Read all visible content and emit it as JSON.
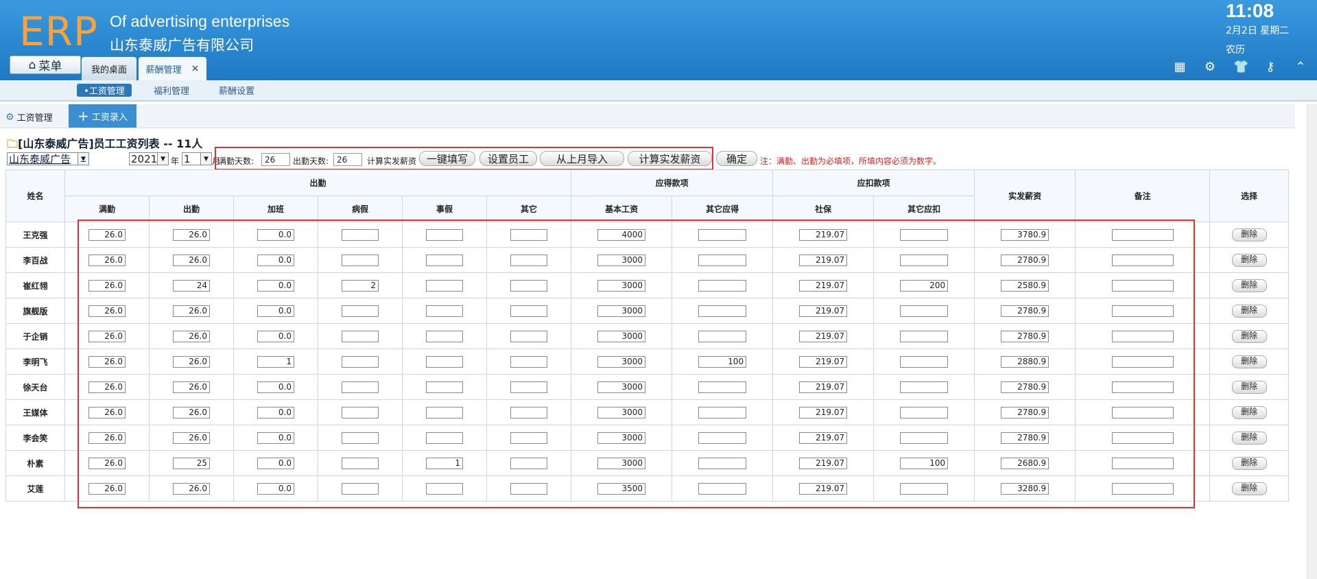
{
  "header": {
    "logo": "ERP",
    "brand_en": "Of advertising enterprises",
    "brand_cn": "山东泰威广告有限公司",
    "time": "11:08",
    "date": "2月2日 星期二",
    "lunar": "农历",
    "menu_label": "菜单",
    "tabs": [
      {
        "label": "我的桌面"
      },
      {
        "label": "薪酬管理",
        "close": "×"
      }
    ],
    "icons": [
      "grid-icon",
      "gear-icon",
      "shirt-icon",
      "key-icon",
      "collapse-icon"
    ]
  },
  "subnav": {
    "items": [
      {
        "label": "•工资管理",
        "active": true
      },
      {
        "label": "福利管理"
      },
      {
        "label": "薪酬设置"
      }
    ]
  },
  "toolbar": {
    "salary_label": "工资管理",
    "entry_label": "工资录入"
  },
  "form": {
    "title": "[山东泰威广告]员工工资列表 -- 11人",
    "company": "山东泰威广告",
    "year": "2021",
    "year_unit": "年",
    "month": "1",
    "month_unit": "月",
    "full_days_label": "满勤天数:",
    "full_days": "26",
    "attend_days_label": "出勤天数:",
    "attend_days": "26",
    "calc_label": "计算实发薪资",
    "buttons": {
      "fill": "一键填写",
      "set_staff": "设置员工",
      "import_last": "从上月导入",
      "calc": "计算实发薪资",
      "confirm": "确定"
    },
    "note": "注：满勤、出勤为必填项，所填内容必须为数字。"
  },
  "table": {
    "headers": {
      "name": "姓名",
      "attendance": "出勤",
      "payable": "应得款项",
      "deduct": "应扣款项",
      "net": "实发薪资",
      "remark": "备注",
      "select": "选择",
      "full": "满勤",
      "attend": "出勤",
      "overtime": "加班",
      "sick": "病假",
      "personal": "事假",
      "other": "其它",
      "base": "基本工资",
      "other_pay": "其它应得",
      "social": "社保",
      "other_deduct": "其它应扣"
    },
    "delete_label": "删除",
    "rows": [
      {
        "name": "王克强",
        "full": "26.0",
        "attend": "26.0",
        "overtime": "0.0",
        "sick": "",
        "personal": "",
        "other": "",
        "base": "4000",
        "other_pay": "",
        "social": "219.07",
        "other_deduct": "",
        "net": "3780.9",
        "remark": ""
      },
      {
        "name": "李百战",
        "full": "26.0",
        "attend": "26.0",
        "overtime": "0.0",
        "sick": "",
        "personal": "",
        "other": "",
        "base": "3000",
        "other_pay": "",
        "social": "219.07",
        "other_deduct": "",
        "net": "2780.9",
        "remark": ""
      },
      {
        "name": "崔红翎",
        "full": "26.0",
        "attend": "24",
        "overtime": "0.0",
        "sick": "2",
        "personal": "",
        "other": "",
        "base": "3000",
        "other_pay": "",
        "social": "219.07",
        "other_deduct": "200",
        "net": "2580.9",
        "remark": ""
      },
      {
        "name": "旗舰版",
        "full": "26.0",
        "attend": "26.0",
        "overtime": "0.0",
        "sick": "",
        "personal": "",
        "other": "",
        "base": "3000",
        "other_pay": "",
        "social": "219.07",
        "other_deduct": "",
        "net": "2780.9",
        "remark": ""
      },
      {
        "name": "于企销",
        "full": "26.0",
        "attend": "26.0",
        "overtime": "0.0",
        "sick": "",
        "personal": "",
        "other": "",
        "base": "3000",
        "other_pay": "",
        "social": "219.07",
        "other_deduct": "",
        "net": "2780.9",
        "remark": ""
      },
      {
        "name": "李明飞",
        "full": "26.0",
        "attend": "26.0",
        "overtime": "1",
        "sick": "",
        "personal": "",
        "other": "",
        "base": "3000",
        "other_pay": "100",
        "social": "219.07",
        "other_deduct": "",
        "net": "2880.9",
        "remark": ""
      },
      {
        "name": "徐天台",
        "full": "26.0",
        "attend": "26.0",
        "overtime": "0.0",
        "sick": "",
        "personal": "",
        "other": "",
        "base": "3000",
        "other_pay": "",
        "social": "219.07",
        "other_deduct": "",
        "net": "2780.9",
        "remark": ""
      },
      {
        "name": "王媒体",
        "full": "26.0",
        "attend": "26.0",
        "overtime": "0.0",
        "sick": "",
        "personal": "",
        "other": "",
        "base": "3000",
        "other_pay": "",
        "social": "219.07",
        "other_deduct": "",
        "net": "2780.9",
        "remark": ""
      },
      {
        "name": "李会笑",
        "full": "26.0",
        "attend": "26.0",
        "overtime": "0.0",
        "sick": "",
        "personal": "",
        "other": "",
        "base": "3000",
        "other_pay": "",
        "social": "219.07",
        "other_deduct": "",
        "net": "2780.9",
        "remark": ""
      },
      {
        "name": "朴素",
        "full": "26.0",
        "attend": "25",
        "overtime": "0.0",
        "sick": "",
        "personal": "1",
        "other": "",
        "base": "3000",
        "other_pay": "",
        "social": "219.07",
        "other_deduct": "100",
        "net": "2680.9",
        "remark": ""
      },
      {
        "name": "艾莲",
        "full": "26.0",
        "attend": "26.0",
        "overtime": "0.0",
        "sick": "",
        "personal": "",
        "other": "",
        "base": "3500",
        "other_pay": "",
        "social": "219.07",
        "other_deduct": "",
        "net": "3280.9",
        "remark": ""
      }
    ]
  },
  "colors": {
    "header_blue": "#1e79c2",
    "logo_orange": "#f7a23a",
    "highlight_red": "#e03030"
  }
}
